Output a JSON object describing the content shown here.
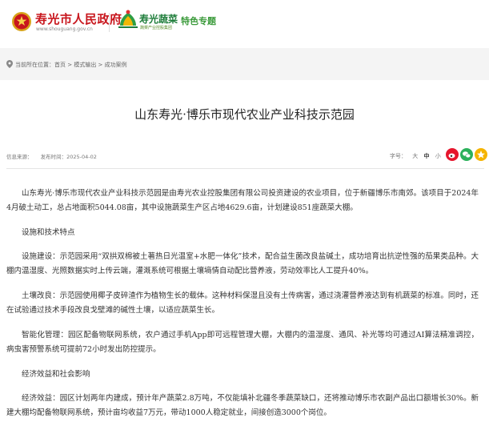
{
  "header": {
    "site_title": "寿光市人民政府",
    "site_url": "www.shouguang.gov.cn",
    "veg_name": "寿光蔬菜",
    "veg_sub": "蔬菜产业控股集团",
    "special": "特色专题",
    "icons": [
      "government-emblem-icon",
      "vegetable-logo-icon"
    ]
  },
  "breadcrumb": {
    "text": "当前所在位置：首页 > 模式输出 > 成功案例"
  },
  "article": {
    "title": "山东寿光·博乐市现代农业产业科技示范园",
    "meta": {
      "source": "信息来源：",
      "date": "发布时间：2025-04-02"
    },
    "font_size": {
      "label": "字号：",
      "large": "大",
      "medium": "中",
      "small": "小"
    },
    "share_colors": {
      "weibo": "#e6162d",
      "wechat": "#2bb15b",
      "qzone": "#f5b400"
    },
    "paragraphs": [
      "山东寿光·博乐市现代农业产业科技示范园是由寿光农业控股集团有限公司投资建设的农业项目，位于新疆博乐市南郊。该项目于2024年4月破土动工，总占地面积5044.08亩，其中设施蔬菜生产区占地4629.6亩，计划建设851座蔬菜大棚。",
      "设施和技术特点",
      "设施建设：示范园采用“双拱双棉被土著热日光温室+水肥一体化”技术，配合益生菌改良盐碱土，成功培育出抗逆性强的茄果类品种。大棚内温湿度、光照数据实时上传云端，灌溉系统可根据土壤墒情自动配比营养液，劳动效率比人工提升40%。",
      "土壤改良：示范园使用椰子皮碎渣作为植物生长的载体。这种材料保湿且没有土传病害，通过浇灌营养液达到有机蔬菜的标准。同时，还在试验通过技术手段改良戈壁滩的碱性土壤，以适应蔬菜生长。",
      "智能化管理：园区配备物联网系统，农户通过手机App即可远程管理大棚，大棚内的温湿度、通风、补光等均可通过AI算法精准调控，病虫害预警系统可提前72小时发出防控提示。",
      "经济效益和社会影响",
      "经济效益：园区计划两年内建成，预计年产蔬菜2.8万吨，不仅能填补北疆冬季蔬菜缺口，还将推动博乐市农副产品出口额增长30%。新建大棚均配备物联网系统，预计亩均收益7万元，带动1000人稳定就业，间接创造3000个岗位。"
    ]
  }
}
